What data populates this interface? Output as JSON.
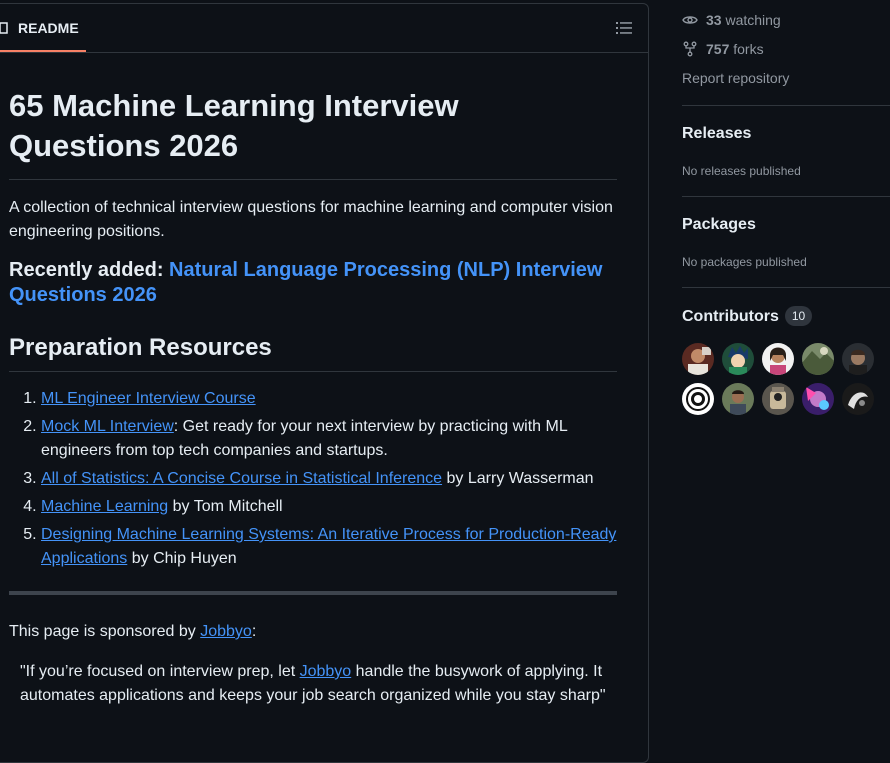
{
  "readme": {
    "tab_label": "README",
    "title": "65 Machine Learning Interview Questions 2026",
    "intro": "A collection of technical interview questions for machine learning and computer vision engineering positions.",
    "recently_added_label": "Recently added:",
    "recently_added_link": "Natural Language Processing (NLP) Interview Questions 2026",
    "prep_heading": "Preparation Resources",
    "resources": [
      {
        "link": "ML Engineer Interview Course",
        "rest": ""
      },
      {
        "link": "Mock ML Interview",
        "rest": ": Get ready for your next interview by practicing with ML engineers from top tech companies and startups."
      },
      {
        "link": "All of Statistics: A Concise Course in Statistical Inference",
        "rest": " by Larry Wasserman"
      },
      {
        "link": "Machine Learning",
        "rest": " by Tom Mitchell"
      },
      {
        "link": "Designing Machine Learning Systems: An Iterative Process for Production-Ready Applications",
        "rest": " by Chip Huyen"
      }
    ],
    "sponsor_prefix": "This page is sponsored by ",
    "sponsor_link": "Jobbyo",
    "sponsor_suffix": ":",
    "quote_prefix": "\"If you’re focused on interview prep, let ",
    "quote_link": "Jobbyo",
    "quote_suffix": " handle the busywork of applying. It automates applications and keeps your job search organized while you stay sharp\""
  },
  "sidebar": {
    "watching_count": "33",
    "watching_label": " watching",
    "forks_count": "757",
    "forks_label": " forks",
    "report_label": "Report repository",
    "releases_heading": "Releases",
    "releases_note": "No releases published",
    "packages_heading": "Packages",
    "packages_note": "No packages published",
    "contributors_heading": "Contributors",
    "contributors_count": "10"
  },
  "colors": {
    "background": "#0d1117",
    "link": "#4493f8",
    "tab_underline": "#f78166",
    "muted_text": "#9198a1"
  },
  "icons": [
    "book-icon",
    "list-unordered-icon",
    "eye-icon",
    "repo-forked-icon"
  ]
}
